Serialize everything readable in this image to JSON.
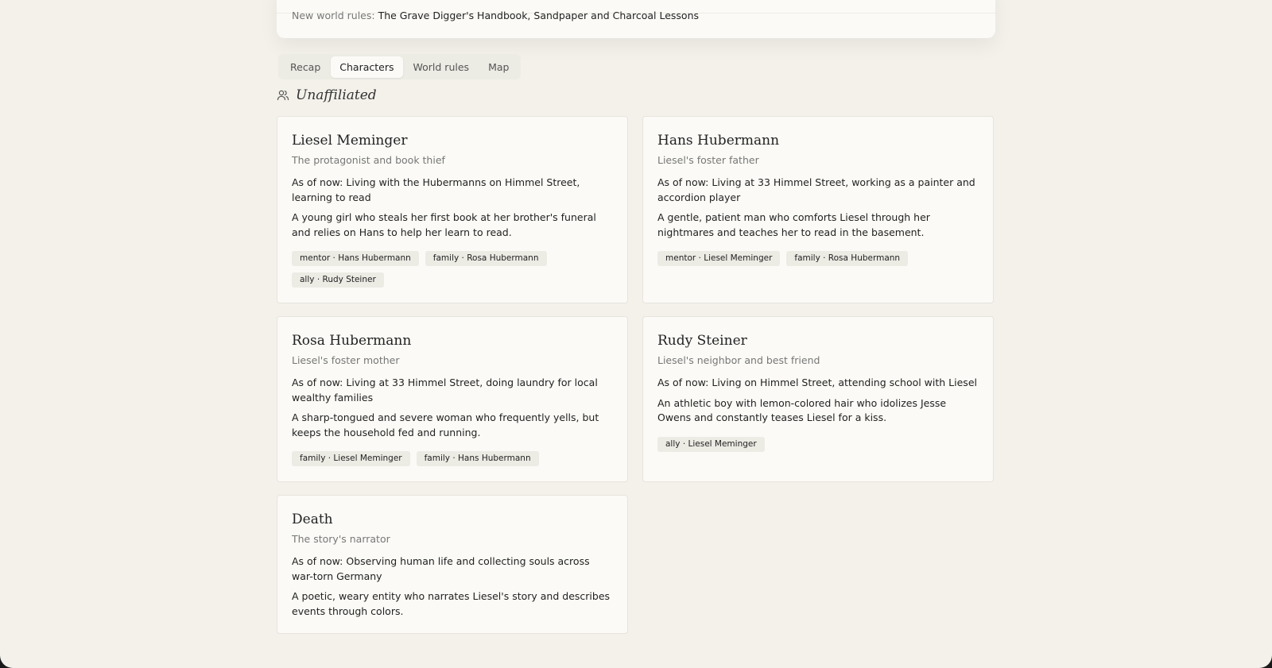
{
  "summary": {
    "label": "New world rules:",
    "value": "The Grave Digger's Handbook, Sandpaper and Charcoal Lessons"
  },
  "tabs": [
    {
      "label": "Recap",
      "active": false
    },
    {
      "label": "Characters",
      "active": true
    },
    {
      "label": "World rules",
      "active": false
    },
    {
      "label": "Map",
      "active": false
    }
  ],
  "section": {
    "title": "Unaffiliated",
    "icon": "users-icon"
  },
  "characters": [
    {
      "name": "Liesel Meminger",
      "role": "The protagonist and book thief",
      "status": "As of now: Living with the Hubermanns on Himmel Street, learning to read",
      "description": "A young girl who steals her first book at her brother's funeral and relies on Hans to help her learn to read.",
      "relations": [
        "mentor · Hans Hubermann",
        "family · Rosa Hubermann",
        "ally · Rudy Steiner"
      ]
    },
    {
      "name": "Hans Hubermann",
      "role": "Liesel's foster father",
      "status": "As of now: Living at 33 Himmel Street, working as a painter and accordion player",
      "description": "A gentle, patient man who comforts Liesel through her nightmares and teaches her to read in the basement.",
      "relations": [
        "mentor · Liesel Meminger",
        "family · Rosa Hubermann"
      ]
    },
    {
      "name": "Rosa Hubermann",
      "role": "Liesel's foster mother",
      "status": "As of now: Living at 33 Himmel Street, doing laundry for local wealthy families",
      "description": "A sharp-tongued and severe woman who frequently yells, but keeps the household fed and running.",
      "relations": [
        "family · Liesel Meminger",
        "family · Hans Hubermann"
      ]
    },
    {
      "name": "Rudy Steiner",
      "role": "Liesel's neighbor and best friend",
      "status": "As of now: Living on Himmel Street, attending school with Liesel",
      "description": "An athletic boy with lemon-colored hair who idolizes Jesse Owens and constantly teases Liesel for a kiss.",
      "relations": [
        "ally · Liesel Meminger"
      ]
    },
    {
      "name": "Death",
      "role": "The story's narrator",
      "status": "As of now: Observing human life and collecting souls across war-torn Germany",
      "description": "A poetic, weary entity who narrates Liesel's story and describes events through colors.",
      "relations": []
    }
  ]
}
